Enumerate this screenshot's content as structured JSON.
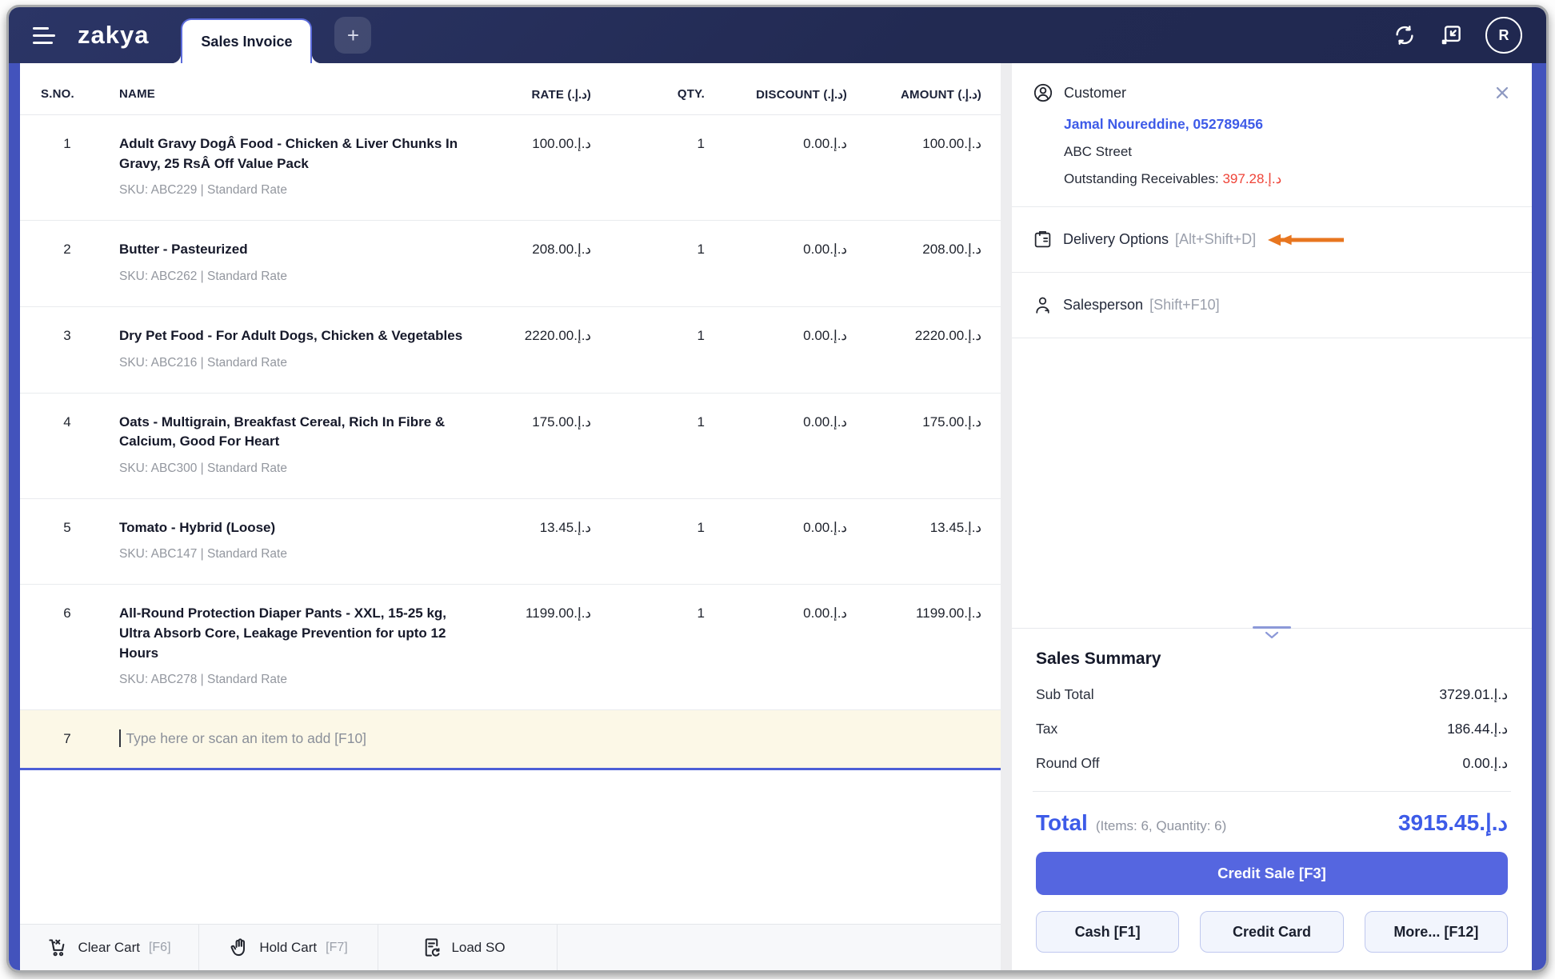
{
  "topbar": {
    "logo": "zakya",
    "tab_label": "Sales Invoice",
    "new_tab": "+",
    "avatar_initial": "R"
  },
  "table": {
    "headers": {
      "sno": "S.NO.",
      "name": "NAME",
      "rate": "RATE (د.إ.‏)",
      "qty": "QTY.",
      "discount": "DISCOUNT (د.إ.‏)",
      "amount": "AMOUNT (د.إ.‏)"
    },
    "rows": [
      {
        "sno": "1",
        "name": "Adult Gravy DogÂ Food - Chicken & Liver Chunks In Gravy, 25 RsÂ Off Value Pack",
        "sku": "SKU: ABC229 | Standard Rate",
        "rate": "100.00د.إ.‏",
        "qty": "1",
        "discount": "0.00د.إ.‏",
        "amount": "100.00د.إ.‏"
      },
      {
        "sno": "2",
        "name": "Butter - Pasteurized",
        "sku": "SKU: ABC262 | Standard Rate",
        "rate": "208.00د.إ.‏",
        "qty": "1",
        "discount": "0.00د.إ.‏",
        "amount": "208.00د.إ.‏"
      },
      {
        "sno": "3",
        "name": "Dry Pet Food - For Adult Dogs, Chicken & Vegetables",
        "sku": "SKU: ABC216 | Standard Rate",
        "rate": "2220.00د.إ.‏",
        "qty": "1",
        "discount": "0.00د.إ.‏",
        "amount": "2220.00د.إ.‏"
      },
      {
        "sno": "4",
        "name": "Oats - Multigrain, Breakfast Cereal, Rich In Fibre & Calcium, Good For Heart",
        "sku": "SKU: ABC300 | Standard Rate",
        "rate": "175.00د.إ.‏",
        "qty": "1",
        "discount": "0.00د.إ.‏",
        "amount": "175.00د.إ.‏"
      },
      {
        "sno": "5",
        "name": "Tomato - Hybrid (Loose)",
        "sku": "SKU: ABC147 | Standard Rate",
        "rate": "13.45د.إ.‏",
        "qty": "1",
        "discount": "0.00د.إ.‏",
        "amount": "13.45د.إ.‏"
      },
      {
        "sno": "6",
        "name": "All-Round Protection Diaper Pants - XXL, 15-25 kg, Ultra Absorb Core, Leakage Prevention for upto 12 Hours",
        "sku": "SKU: ABC278 | Standard Rate",
        "rate": "1199.00د.إ.‏",
        "qty": "1",
        "discount": "0.00د.إ.‏",
        "amount": "1199.00د.إ.‏"
      }
    ],
    "input_row": {
      "sno": "7",
      "placeholder": "Type here or scan an item to add  [F10]"
    }
  },
  "footer": {
    "buttons": [
      {
        "label": "Clear Cart",
        "key": "[F6]"
      },
      {
        "label": "Hold Cart",
        "key": "[F7]"
      },
      {
        "label": "Load SO",
        "key": ""
      }
    ]
  },
  "customer": {
    "title": "Customer",
    "name": "Jamal Noureddine, 052789456",
    "address": "ABC Street",
    "outstanding_label": "Outstanding Receivables: ",
    "outstanding_value": "397.28د.إ.‏"
  },
  "options": {
    "delivery_label": "Delivery Options",
    "delivery_key": "[Alt+Shift+D]",
    "salesperson_label": "Salesperson",
    "salesperson_key": "[Shift+F10]"
  },
  "summary": {
    "title": "Sales Summary",
    "rows": [
      {
        "label": "Sub Total",
        "value": "3729.01د.إ.‏"
      },
      {
        "label": "Tax",
        "value": "186.44د.إ.‏"
      },
      {
        "label": "Round Off",
        "value": "0.00د.إ.‏"
      }
    ],
    "total_label": "Total",
    "total_meta": "(Items: 6, Quantity: 6)",
    "total_value": "3915.45د.إ.‏"
  },
  "payment": {
    "credit_sale": "Credit Sale [F3]",
    "cash": "Cash [F1]",
    "credit_card": "Credit Card",
    "more": "More... [F12]"
  },
  "colors": {
    "topbar_navy": "#232a52",
    "accent_indigo": "#5566e0",
    "edge_strip": "#4353bc",
    "link_blue": "#3e5be8",
    "alert_red": "#ef4438",
    "annotation_orange": "#e8761f",
    "input_row_cream": "#fcf8e7"
  }
}
